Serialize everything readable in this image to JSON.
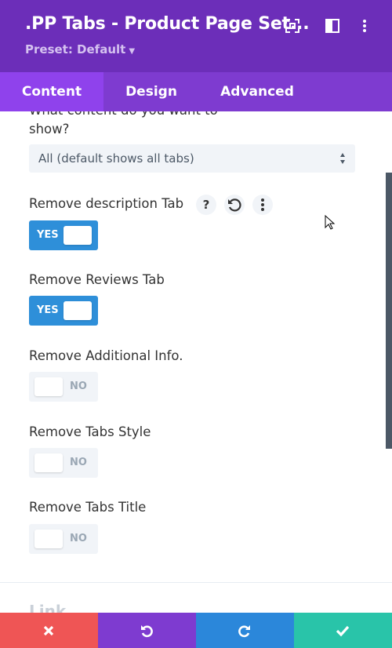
{
  "header": {
    "title": ".PP Tabs - Product Page Set...",
    "preset": "Preset: Default",
    "icons": [
      "expand-icon",
      "sidebar-layout-icon",
      "more-vertical-icon"
    ]
  },
  "tabs": [
    {
      "label": "Content",
      "active": true
    },
    {
      "label": "Design",
      "active": false
    },
    {
      "label": "Advanced",
      "active": false
    }
  ],
  "fields": {
    "show_question_line1": "What content do you want to",
    "show_question_line2": "show?",
    "show_select_value": "All (default shows all tabs)",
    "remove_description": {
      "label": "Remove description Tab",
      "toggle": "YES"
    },
    "remove_reviews": {
      "label": "Remove Reviews Tab",
      "toggle": "YES"
    },
    "remove_additional": {
      "label": "Remove Additional Info.",
      "toggle": "NO"
    },
    "remove_tabs_style": {
      "label": "Remove Tabs Style",
      "toggle": "NO"
    },
    "remove_tabs_title": {
      "label": "Remove Tabs Title",
      "toggle": "NO"
    },
    "field_icons": {
      "help": "?",
      "reset": "reset-icon",
      "more": "more-vertical-icon"
    }
  },
  "next_section": "Link",
  "footer": {
    "buttons": [
      "close-icon",
      "undo-icon",
      "redo-icon",
      "check-icon"
    ],
    "colors": {
      "cancel": "#ef5555",
      "undo": "#7e3bd0",
      "redo": "#2b87da",
      "save": "#29c4a9"
    }
  },
  "colors": {
    "header": "#6c2eb9",
    "tabs": "#7e3bd0",
    "active_tab": "#8f42ec",
    "toggle_on": "#2e8fd9"
  }
}
